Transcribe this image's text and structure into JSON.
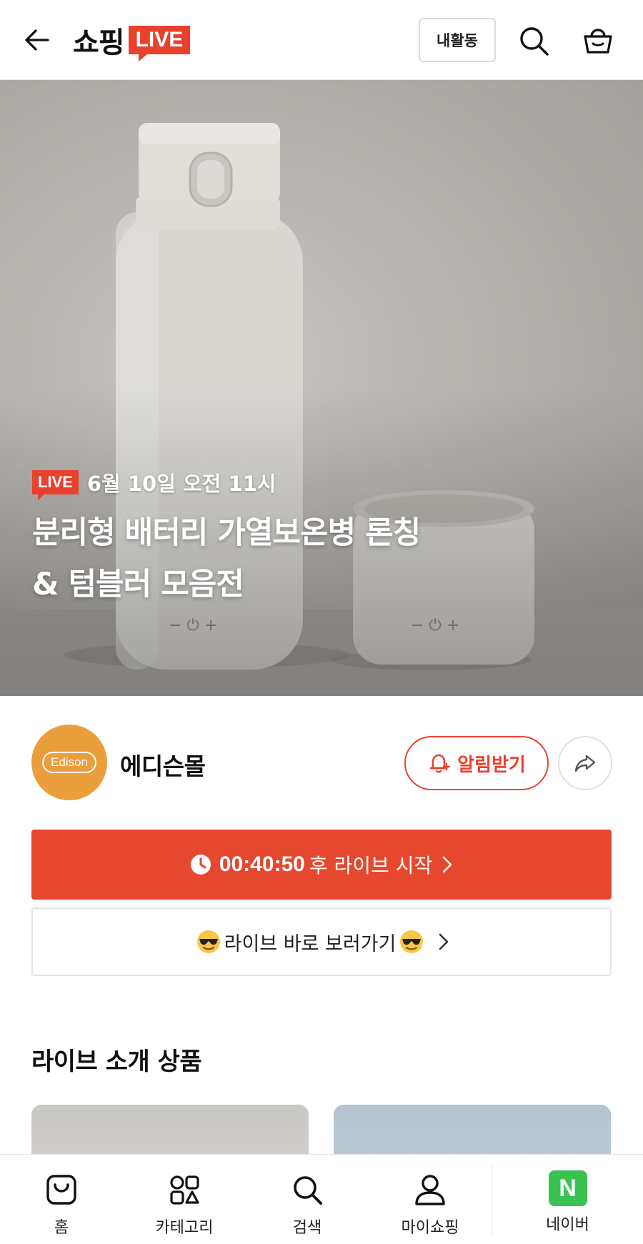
{
  "header": {
    "brand_text": "쇼핑",
    "brand_badge": "LIVE",
    "activity_label": "내활동"
  },
  "hero": {
    "live_badge": "LIVE",
    "schedule": "6월 10일 오전 11시",
    "title_line1": "분리형 배터리 가열보온병 론칭",
    "title_line2": "& 텀블러 모음전"
  },
  "store": {
    "logo_text": "Edison",
    "name": "에디슨몰",
    "notify_label": "알림받기"
  },
  "countdown": {
    "timer": "00:40:50",
    "suffix": "후 라이브 시작"
  },
  "go_live": {
    "label": "라이브 바로 보러가기"
  },
  "section": {
    "title": "라이브 소개 상품"
  },
  "bottom_nav": {
    "items": [
      {
        "label": "홈",
        "icon": "home-bag-icon"
      },
      {
        "label": "카테고리",
        "icon": "category-icon"
      },
      {
        "label": "검색",
        "icon": "search-icon"
      },
      {
        "label": "마이쇼핑",
        "icon": "person-icon"
      },
      {
        "label": "네이버",
        "icon": "naver-n-icon",
        "logo_letter": "N"
      }
    ]
  },
  "colors": {
    "accent": "#e8422e",
    "naver_green": "#39c251",
    "store_orange": "#eb9e3c"
  }
}
